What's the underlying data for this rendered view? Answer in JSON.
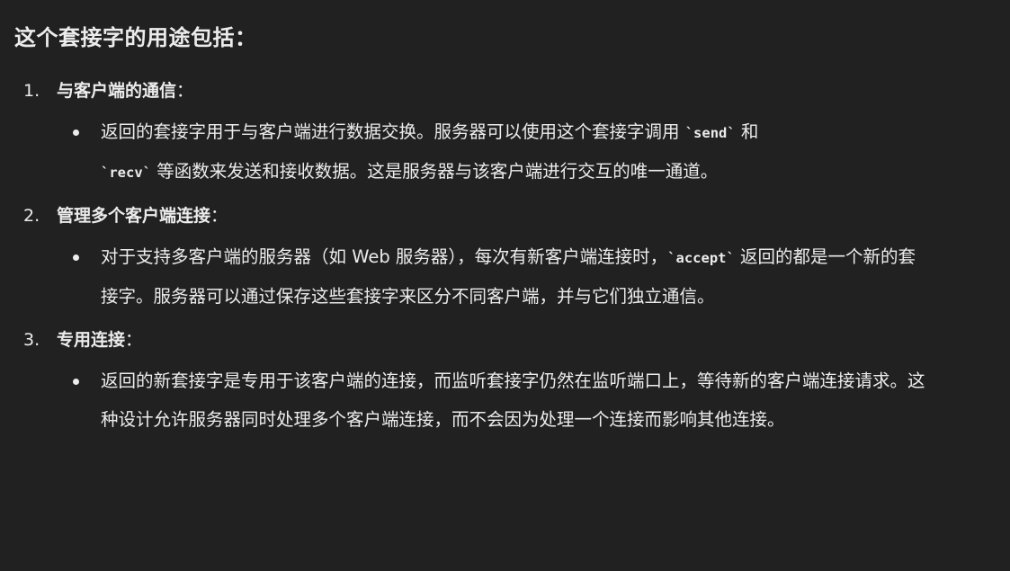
{
  "heading": "这个套接字的用途包括：",
  "items": [
    {
      "number": "1.",
      "title": "与客户端的通信",
      "colon": "：",
      "bullet": {
        "t1": "返回的套接字用于与客户端进行数据交换。服务器可以使用这个套接字调用 ",
        "c1": "`send`",
        "t2": " 和 ",
        "c2": "`recv`",
        "t3": " 等函数来发送和接收数据。这是服务器与该客户端进行交互的唯一通道。"
      }
    },
    {
      "number": "2.",
      "title": "管理多个客户端连接",
      "colon": "：",
      "bullet": {
        "t1": "对于支持多客户端的服务器（如 Web 服务器），每次有新客户端连接时，",
        "c1": "`accept`",
        "t2": " 返回的都是一个新的套接字。服务器可以通过保存这些套接字来区分不同客户端，并与它们独立通信。"
      }
    },
    {
      "number": "3.",
      "title": "专用连接",
      "colon": "：",
      "bullet": {
        "t1": "返回的新套接字是专用于该客户端的连接，而监听套接字仍然在监听端口上，等待新的客户端连接请求。这种设计允许服务器同时处理多个客户端连接，而不会因为处理一个连接而影响其他连接。"
      }
    }
  ]
}
